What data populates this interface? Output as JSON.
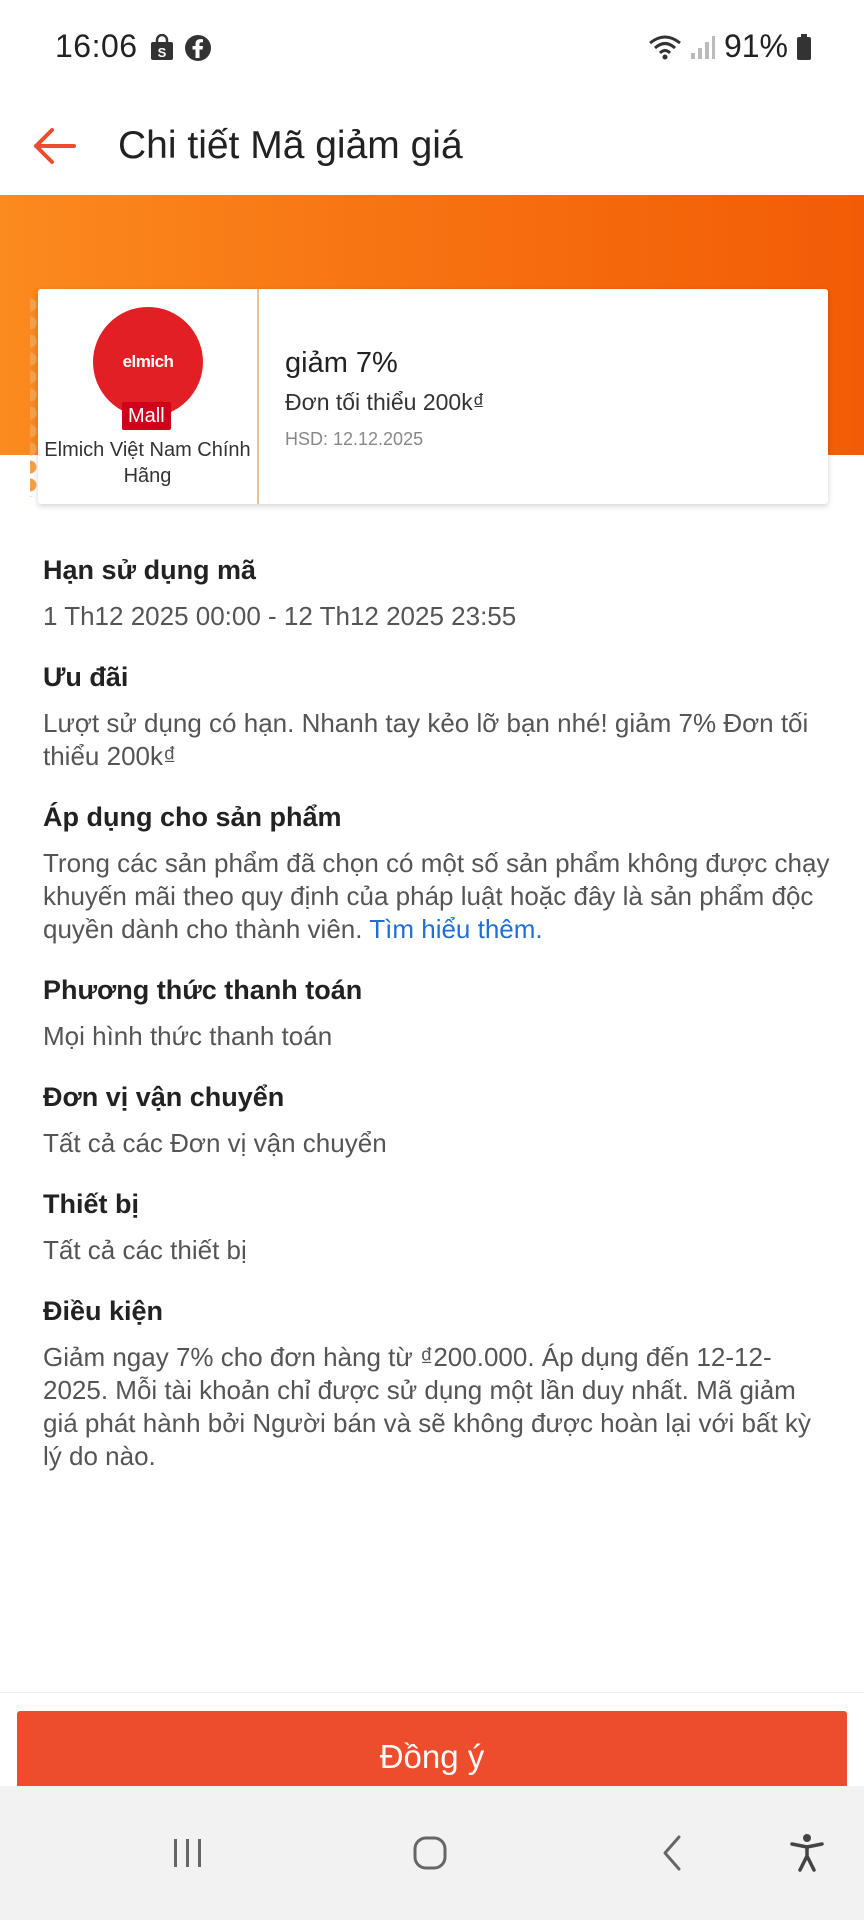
{
  "status_bar": {
    "time": "16:06",
    "left_icons": [
      "shopee-bag-icon",
      "facebook-icon"
    ],
    "battery": "91%"
  },
  "header": {
    "title": "Chi tiết Mã giảm giá",
    "back_icon": "arrow-left-icon"
  },
  "voucher": {
    "logo_text": "elmich",
    "badge": "Mall",
    "shop_name": "Elmich Việt Nam Chính Hãng",
    "discount": "giảm 7%",
    "minimum": "Đơn tối thiểu 200k₫",
    "expiry": "HSD: 12.12.2025"
  },
  "sections": [
    {
      "heading": "Hạn sử dụng mã",
      "body": "1 Th12 2025 00:00 - 12 Th12 2025 23:55"
    },
    {
      "heading": "Ưu đãi",
      "body": "Lượt sử dụng có hạn. Nhanh tay kẻo lỡ bạn nhé! giảm 7% Đơn tối thiểu 200k₫"
    },
    {
      "heading": "Áp dụng cho sản phẩm",
      "body": "Trong các sản phẩm đã chọn có một số sản phẩm không được chạy khuyến mãi theo quy định của pháp luật hoặc đây là sản phẩm độc quyền dành cho thành viên.",
      "link": "Tìm hiểu thêm."
    },
    {
      "heading": "Phương thức thanh toán",
      "body": "Mọi hình thức thanh toán"
    },
    {
      "heading": "Đơn vị vận chuyển",
      "body": "Tất cả các Đơn vị vận chuyển"
    },
    {
      "heading": "Thiết bị",
      "body": "Tất cả các thiết bị"
    },
    {
      "heading": "Điều kiện",
      "body": "Giảm ngay 7% cho đơn hàng từ ₫200.000. Áp dụng đến 12-12-2025. Mỗi tài khoản chỉ được sử dụng một lần duy nhất. Mã giảm giá phát hành bởi Người bán và sẽ không được hoàn lại với bất kỳ lý do nào."
    }
  ],
  "action": {
    "agree_label": "Đồng ý"
  },
  "colors": {
    "accent": "#ee4d2d",
    "banner": "#f66f10",
    "link": "#1f6fd6",
    "mall": "#d0011b"
  }
}
